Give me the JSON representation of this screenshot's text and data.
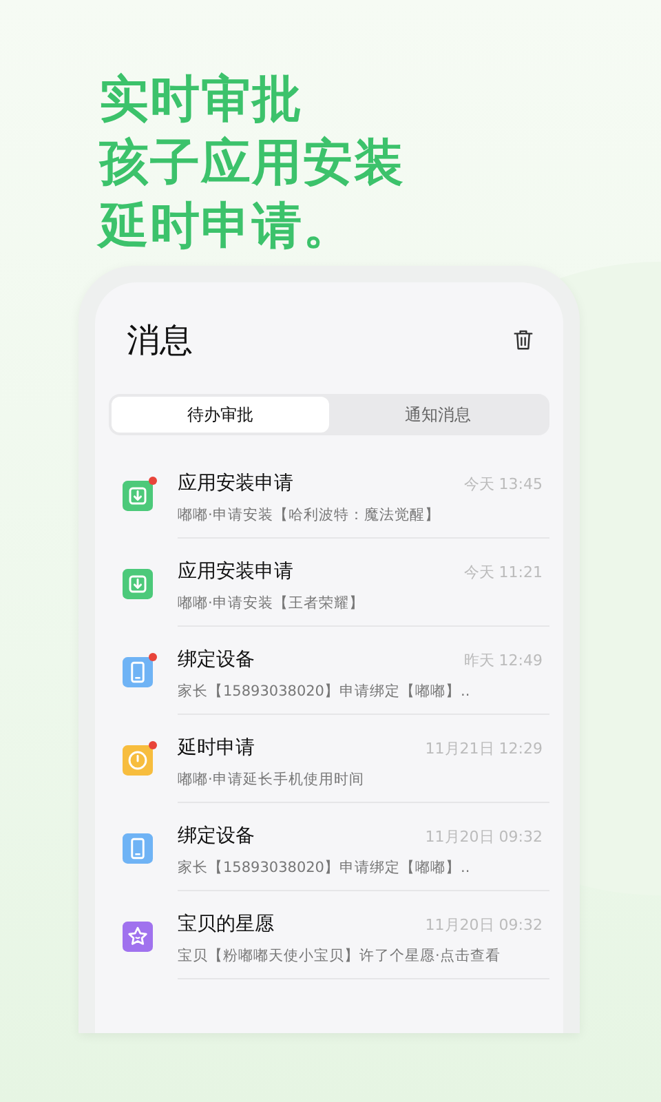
{
  "headline": [
    "实时审批",
    "孩子应用安装",
    "延时申请。"
  ],
  "screen": {
    "title": "消息",
    "tabs": [
      {
        "label": "待办审批",
        "selected": true
      },
      {
        "label": "通知消息",
        "selected": false
      }
    ],
    "messages": [
      {
        "kind": "install",
        "unread": true,
        "title": "应用安装申请",
        "time": "今天 13:45",
        "detail": "嘟嘟·申请安装【哈利波特：魔法觉醒】"
      },
      {
        "kind": "install",
        "unread": false,
        "title": "应用安装申请",
        "time": "今天 11:21",
        "detail": "嘟嘟·申请安装【王者荣耀】"
      },
      {
        "kind": "bind",
        "unread": true,
        "title": "绑定设备",
        "time": "昨天 12:49",
        "detail": "家长【15893038020】申请绑定【嘟嘟】.."
      },
      {
        "kind": "delay",
        "unread": true,
        "title": "延时申请",
        "time": "11月21日 12:29",
        "detail": "嘟嘟·申请延长手机使用时间"
      },
      {
        "kind": "bind",
        "unread": false,
        "title": "绑定设备",
        "time": "11月20日 09:32",
        "detail": "家长【15893038020】申请绑定【嘟嘟】.."
      },
      {
        "kind": "wish",
        "unread": false,
        "title": "宝贝的星愿",
        "time": "11月20日 09:32",
        "detail": "宝贝【粉嘟嘟天使小宝贝】许了个星愿·点击查看"
      }
    ]
  }
}
